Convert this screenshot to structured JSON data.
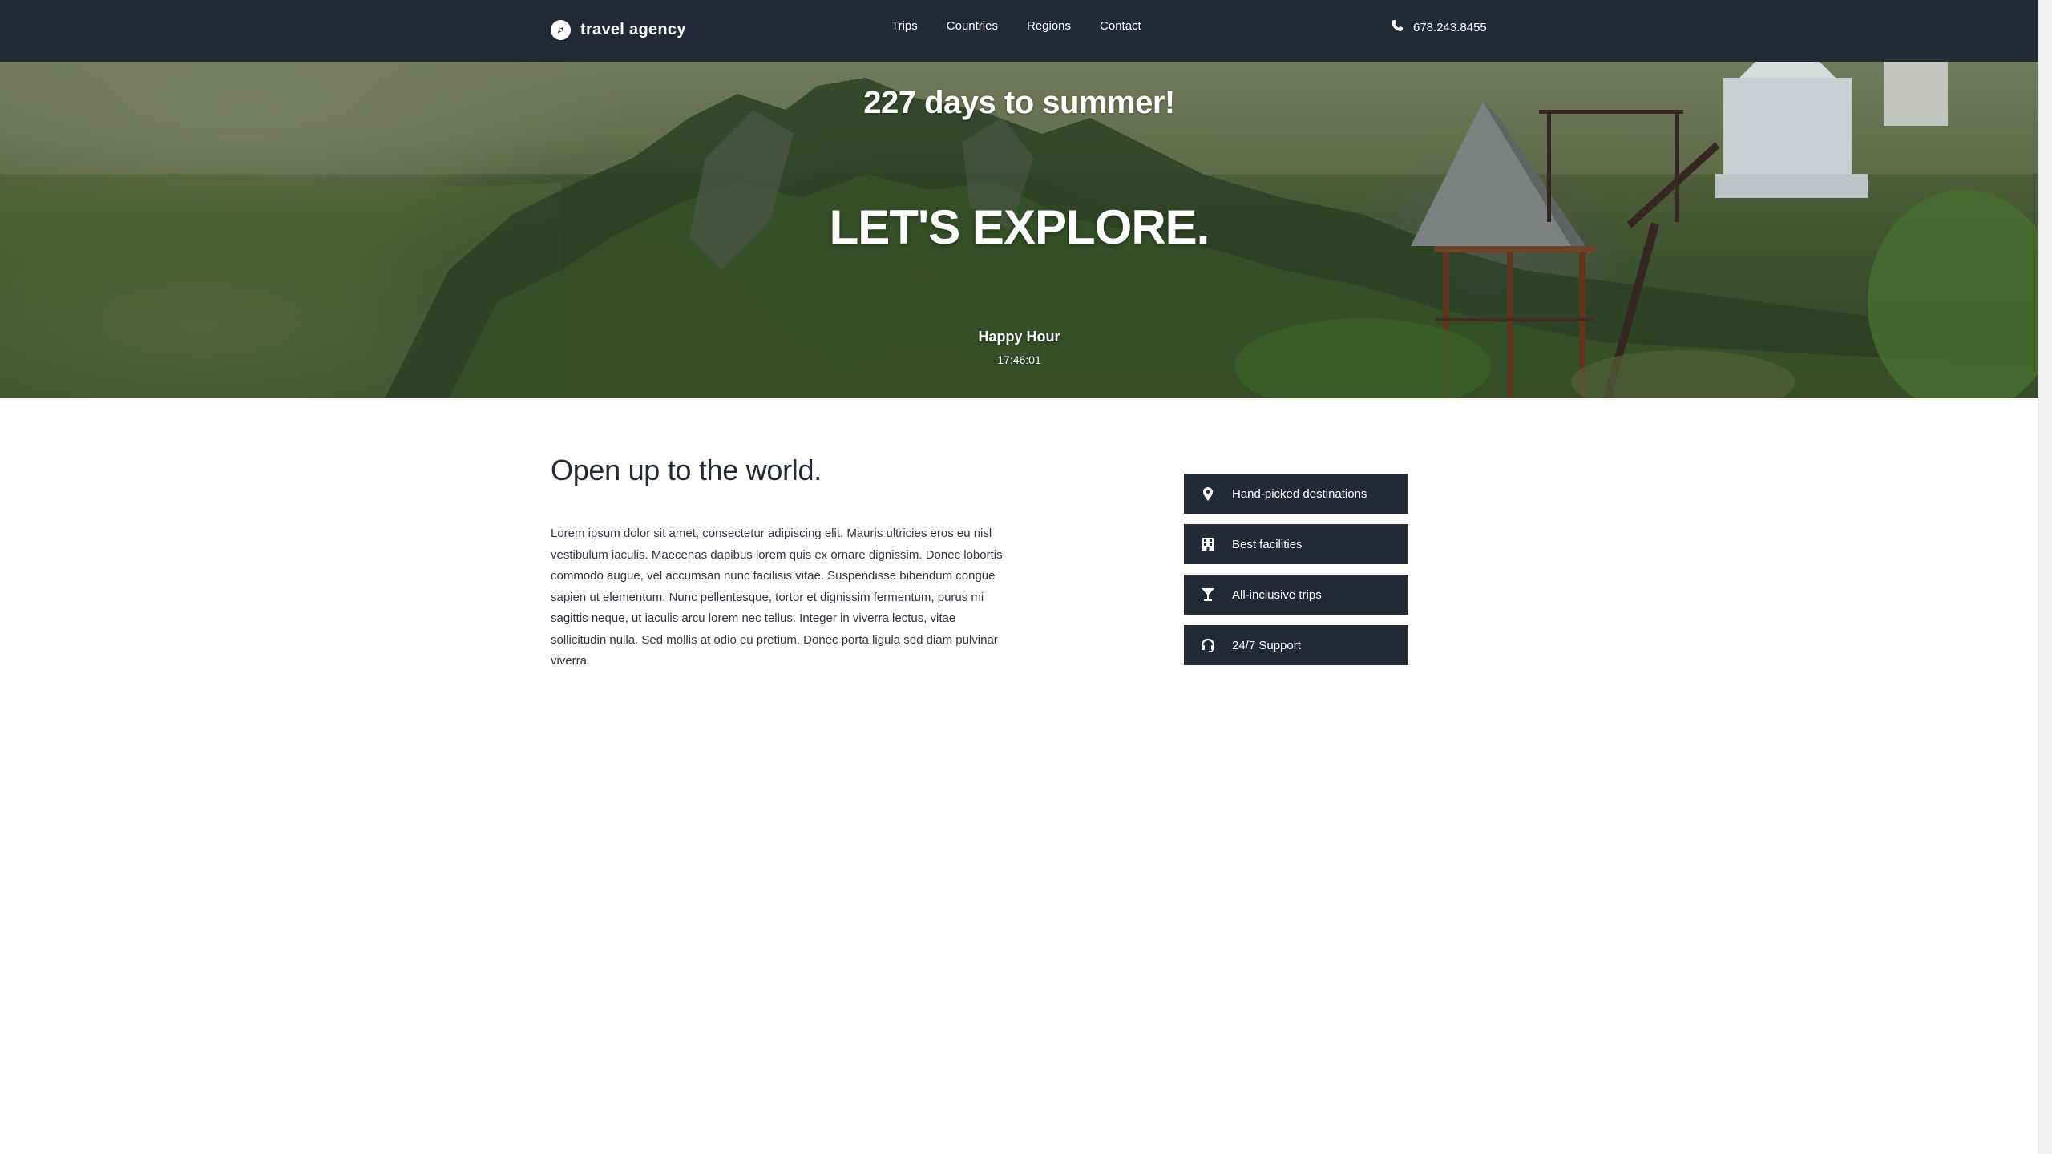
{
  "header": {
    "brand": "travel agency",
    "nav": [
      "Trips",
      "Countries",
      "Regions",
      "Contact"
    ],
    "phone": "678.243.8455"
  },
  "hero": {
    "countdown": "227 days to summer!",
    "headline": "LET'S EXPLORE.",
    "event_label": "Happy Hour",
    "event_time": "17:46:01"
  },
  "main": {
    "title": "Open up to the world.",
    "body": "Lorem ipsum dolor sit amet, consectetur adipiscing elit. Mauris ultricies eros eu nisl vestibulum iaculis. Maecenas dapibus lorem quis ex ornare dignissim. Donec lobortis commodo augue, vel accumsan nunc facilisis vitae. Suspendisse bibendum congue sapien ut elementum. Nunc pellentesque, tortor et dignissim fermentum, purus mi sagittis neque, ut iaculis arcu lorem nec tellus. Integer in viverra lectus, vitae sollicitudin nulla. Sed mollis at odio eu pretium. Donec porta ligula sed diam pulvinar viverra."
  },
  "features": [
    {
      "label": "Hand-picked destinations",
      "icon": "map-marker-icon"
    },
    {
      "label": "Best facilities",
      "icon": "building-icon"
    },
    {
      "label": "All-inclusive trips",
      "icon": "cocktail-icon"
    },
    {
      "label": "24/7 Support",
      "icon": "headset-icon"
    }
  ],
  "colors": {
    "header_bg": "#232a36",
    "button_bg": "#232a36",
    "text": "#232a36"
  }
}
